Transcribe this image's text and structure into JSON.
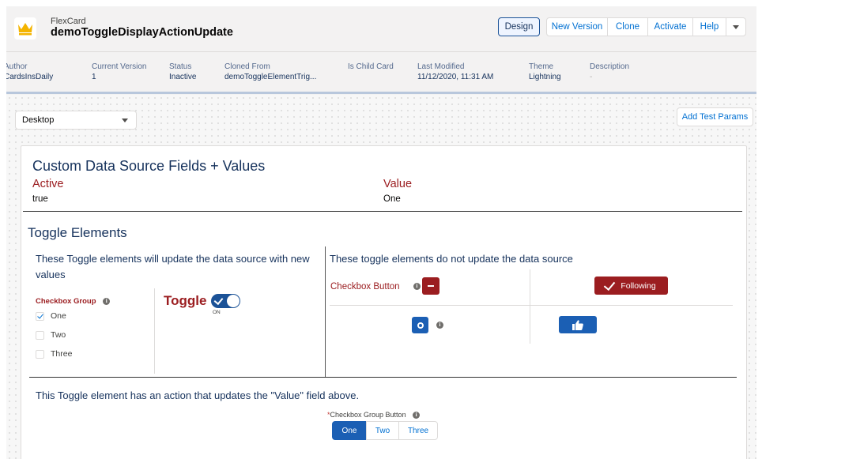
{
  "header": {
    "object_type": "FlexCard",
    "title": "demoToggleDisplayActionUpdate",
    "buttons": [
      "Design",
      "New Version",
      "Clone",
      "Activate",
      "Help"
    ]
  },
  "details": [
    {
      "label": "Author",
      "value": "CardsInsDaily"
    },
    {
      "label": "Current Version",
      "value": "1"
    },
    {
      "label": "Status",
      "value": "Inactive"
    },
    {
      "label": "Cloned From",
      "value": "demoToggleElementTrig..."
    },
    {
      "label": "Is Child Card",
      "value": ""
    },
    {
      "label": "Last Modified",
      "value": "11/12/2020, 11:31 AM"
    },
    {
      "label": "Theme",
      "value": "Lightning"
    },
    {
      "label": "Description",
      "value": "-"
    }
  ],
  "canvas": {
    "device_select": "Desktop",
    "add_test_params": "Add Test Params"
  },
  "card": {
    "title": "Custom Data Source Fields + Values",
    "fields": [
      {
        "label": "Active",
        "value": "true"
      },
      {
        "label": "Value",
        "value": "One"
      }
    ],
    "toggle_title": "Toggle Elements",
    "left_text": "These Toggle elements will update the data source with new values",
    "right_text": "These toggle elements do not update the data source",
    "checkbox_group": {
      "label": "Checkbox Group",
      "options": [
        "One",
        "Two",
        "Three"
      ],
      "checked": "One"
    },
    "toggle_label": "Toggle",
    "toggle_state": "ON",
    "checkbox_button_label": "Checkbox Button",
    "following_label": "Following",
    "bottom_text": "This Toggle element has an action that updates the \"Value\" field above.",
    "checkbox_group_button": {
      "label": "Checkbox Group Button",
      "options": [
        "One",
        "Two",
        "Three"
      ],
      "selected": "One"
    }
  },
  "colors": {
    "brand_red": "#9b1d20",
    "brand_blue": "#1b5fb4",
    "link_blue": "#0070d2"
  },
  "icons": {
    "logo": "crown-icon",
    "info": "info-icon",
    "dropdown": "chevron-down-icon",
    "thumb": "thumbs-up-icon"
  }
}
